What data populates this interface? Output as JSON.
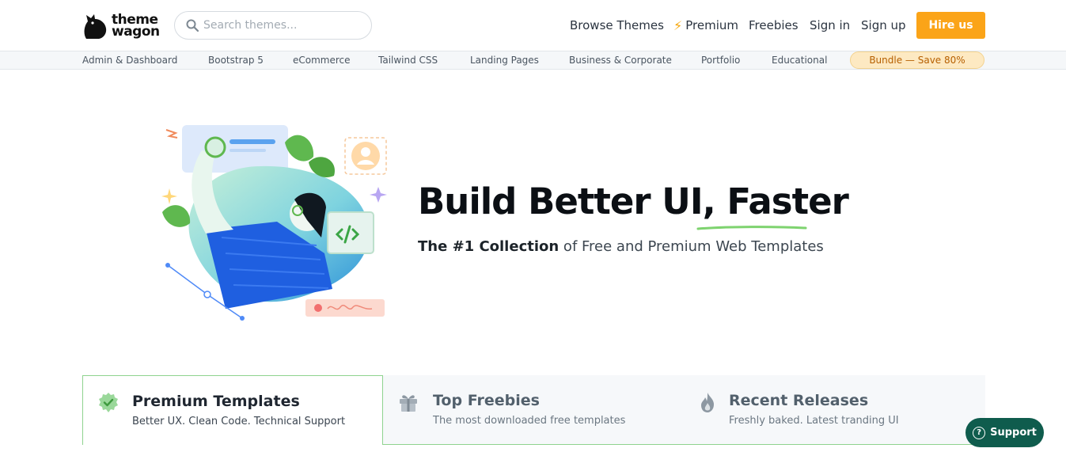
{
  "brand": {
    "logo_line1": "theme",
    "logo_line2": "wagon"
  },
  "search": {
    "placeholder": "Search themes..."
  },
  "nav": {
    "browse": "Browse Themes",
    "premium": "Premium",
    "freebies": "Freebies",
    "signin": "Sign in",
    "signup": "Sign up",
    "hire": "Hire us"
  },
  "categories": [
    "Admin & Dashboard",
    "Bootstrap 5",
    "eCommerce",
    "Tailwind CSS",
    "Landing Pages",
    "Business & Corporate",
    "Portfolio",
    "Educational"
  ],
  "bundle": "Bundle — Save 80%",
  "hero": {
    "title": "Build Better UI, Faster",
    "sub_bold": "The #1 Collection",
    "sub_rest": " of Free and Premium Web Templates"
  },
  "tabs": [
    {
      "title": "Premium Templates",
      "desc": "Better UX. Clean Code. Technical Support"
    },
    {
      "title": "Top Freebies",
      "desc": "The most downloaded free templates"
    },
    {
      "title": "Recent Releases",
      "desc": "Freshly baked. Latest tranding UI"
    }
  ],
  "support": {
    "label": "Support"
  },
  "colors": {
    "accent": "#fba418",
    "support": "#0f5c4d",
    "tab_border": "#8fd38f"
  }
}
